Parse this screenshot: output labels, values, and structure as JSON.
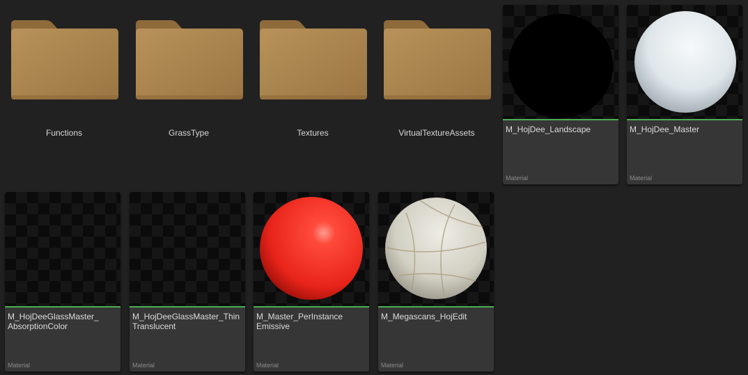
{
  "colors": {
    "background": "#212121",
    "tile_bg": "#363636",
    "material_accent": "#4caf50",
    "folder": "#b08a52"
  },
  "folders": [
    {
      "label": "Functions",
      "icon": "folder-icon"
    },
    {
      "label": "GrassType",
      "icon": "folder-icon"
    },
    {
      "label": "Textures",
      "icon": "folder-icon"
    },
    {
      "label": "VirtualTextureAssets",
      "icon": "folder-icon"
    }
  ],
  "assets": [
    {
      "name": "M_HojDee_Landscape",
      "type": "Material",
      "preview": "black-sphere"
    },
    {
      "name": "M_HojDee_Master",
      "type": "Material",
      "preview": "white-sphere"
    },
    {
      "name": "M_HojDeeGlassMaster_\nAbsorptionColor",
      "type": "Material",
      "preview": "empty"
    },
    {
      "name": "M_HojDeeGlassMaster_Thin\nTranslucent",
      "type": "Material",
      "preview": "empty"
    },
    {
      "name": "M_Master_PerInstance\nEmissive",
      "type": "Material",
      "preview": "red-sphere"
    },
    {
      "name": "M_Megascans_HojEdit",
      "type": "Material",
      "preview": "stone-sphere"
    }
  ]
}
